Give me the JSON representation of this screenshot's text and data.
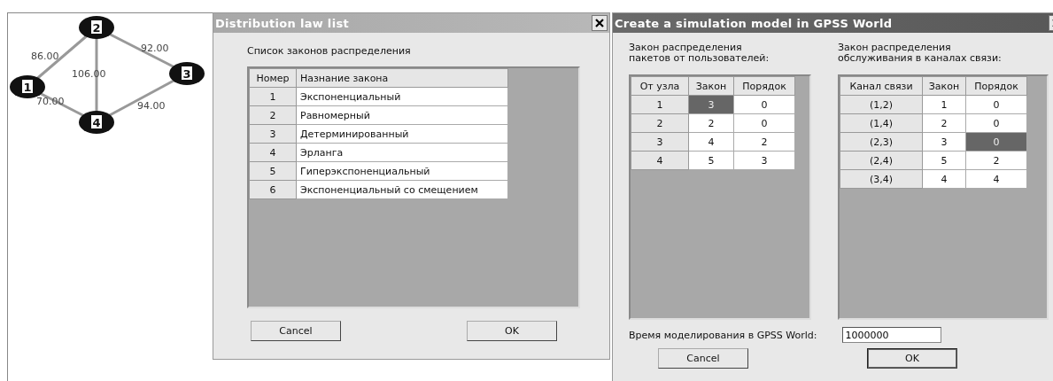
{
  "graph": {
    "nodes": [
      {
        "label": "1"
      },
      {
        "label": "2"
      },
      {
        "label": "3"
      },
      {
        "label": "4"
      }
    ],
    "edges": [
      {
        "label": "86.00"
      },
      {
        "label": "92.00"
      },
      {
        "label": "106.00"
      },
      {
        "label": "70.00"
      },
      {
        "label": "94.00"
      }
    ]
  },
  "law_dialog": {
    "title": "Distribution law list",
    "active": false,
    "caption": "Список законов распределения",
    "columns": [
      "Номер",
      "Назнание закона"
    ],
    "rows": [
      {
        "number": "1",
        "name": "Экспоненциальный"
      },
      {
        "number": "2",
        "name": "Равномерный"
      },
      {
        "number": "3",
        "name": "Детерминированный"
      },
      {
        "number": "4",
        "name": "Эрланга"
      },
      {
        "number": "5",
        "name": "Гиперэкспоненциальный"
      },
      {
        "number": "6",
        "name": "Экспоненциальный со смещением"
      }
    ],
    "buttons": [
      {
        "label": "Cancel",
        "default": false
      },
      {
        "label": "OK",
        "default": false
      }
    ]
  },
  "model_dialog": {
    "title": "Create a simulation model in GPSS World",
    "active": true,
    "tables": [
      {
        "caption": "Закон распределения\nпакетов от пользователей:",
        "columns": [
          "От узла",
          "Закон",
          "Порядок"
        ],
        "rows": [
          {
            "cells": [
              {
                "kind": "header",
                "text": "1",
                "selected": false
              },
              {
                "kind": "data",
                "text": "3",
                "selected": true
              },
              {
                "kind": "data",
                "text": "0",
                "selected": false
              }
            ]
          },
          {
            "cells": [
              {
                "kind": "header",
                "text": "2",
                "selected": false
              },
              {
                "kind": "data",
                "text": "2",
                "selected": false
              },
              {
                "kind": "data",
                "text": "0",
                "selected": false
              }
            ]
          },
          {
            "cells": [
              {
                "kind": "header",
                "text": "3",
                "selected": false
              },
              {
                "kind": "data",
                "text": "4",
                "selected": false
              },
              {
                "kind": "data",
                "text": "2",
                "selected": false
              }
            ]
          },
          {
            "cells": [
              {
                "kind": "header",
                "text": "4",
                "selected": false
              },
              {
                "kind": "data",
                "text": "5",
                "selected": false
              },
              {
                "kind": "data",
                "text": "3",
                "selected": false
              }
            ]
          }
        ]
      },
      {
        "caption": "Закон распределения\nобслуживания в каналах связи:",
        "columns": [
          "Канал связи",
          "Закон",
          "Порядок"
        ],
        "rows": [
          {
            "cells": [
              {
                "kind": "header",
                "text": "(1,2)",
                "selected": false
              },
              {
                "kind": "data",
                "text": "1",
                "selected": false
              },
              {
                "kind": "data",
                "text": "0",
                "selected": false
              }
            ]
          },
          {
            "cells": [
              {
                "kind": "header",
                "text": "(1,4)",
                "selected": false
              },
              {
                "kind": "data",
                "text": "2",
                "selected": false
              },
              {
                "kind": "data",
                "text": "0",
                "selected": false
              }
            ]
          },
          {
            "cells": [
              {
                "kind": "header",
                "text": "(2,3)",
                "selected": false
              },
              {
                "kind": "data",
                "text": "3",
                "selected": false
              },
              {
                "kind": "data",
                "text": "0",
                "selected": true
              }
            ]
          },
          {
            "cells": [
              {
                "kind": "header",
                "text": "(2,4)",
                "selected": false
              },
              {
                "kind": "data",
                "text": "5",
                "selected": false
              },
              {
                "kind": "data",
                "text": "2",
                "selected": false
              }
            ]
          },
          {
            "cells": [
              {
                "kind": "header",
                "text": "(3,4)",
                "selected": false
              },
              {
                "kind": "data",
                "text": "4",
                "selected": false
              },
              {
                "kind": "data",
                "text": "4",
                "selected": false
              }
            ]
          }
        ]
      }
    ],
    "time_label": "Время моделирования в GPSS World:",
    "time_value": "1000000",
    "buttons": [
      {
        "label": "Cancel",
        "default": false
      },
      {
        "label": "OK",
        "default": true
      }
    ]
  }
}
